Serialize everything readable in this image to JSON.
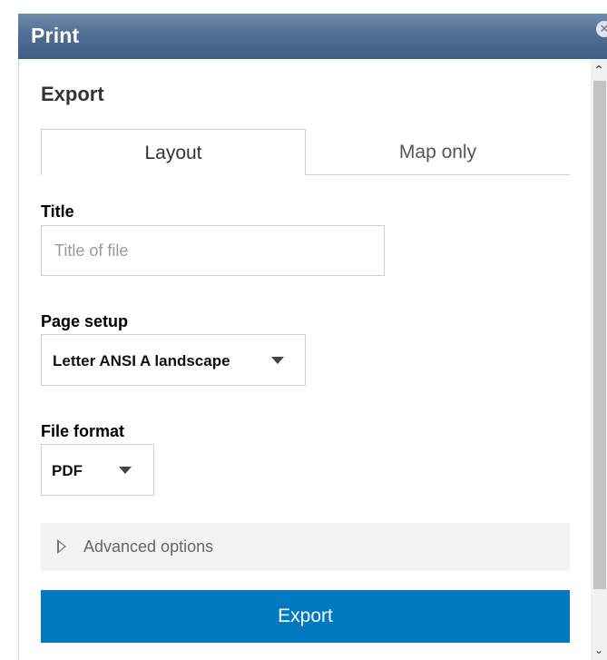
{
  "window": {
    "title": "Print",
    "close_icon": "close-icon"
  },
  "export": {
    "heading": "Export",
    "tabs": [
      {
        "label": "Layout",
        "selected": true
      },
      {
        "label": "Map only",
        "selected": false
      }
    ],
    "title_field": {
      "label": "Title",
      "value": "",
      "placeholder": "Title of file"
    },
    "page_setup": {
      "label": "Page setup",
      "selected": "Letter ANSI A landscape"
    },
    "file_format": {
      "label": "File format",
      "selected": "PDF"
    },
    "advanced_options": {
      "label": "Advanced options",
      "expanded": false
    },
    "export_button": {
      "label": "Export"
    }
  },
  "colors": {
    "titlebar": "#516f93",
    "export_button": "#0079c1",
    "advanced_background": "#f3f3f3"
  }
}
